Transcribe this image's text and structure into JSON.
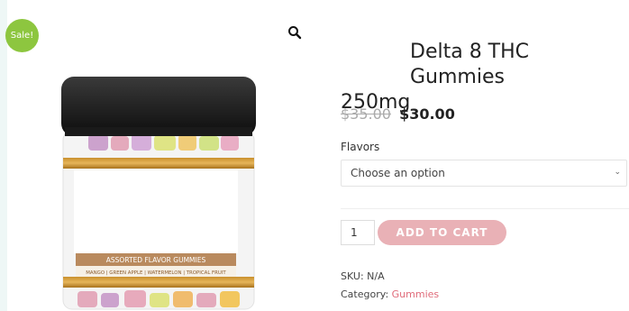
{
  "sale_badge": "Sale!",
  "product": {
    "title_line1": "Delta 8 THC Gummies",
    "title_line2": "250mg",
    "old_price": "$35.00",
    "new_price": "$30.00"
  },
  "jar_label": {
    "name": "ASSORTED FLAVOR GUMMIES",
    "flavors": "MANGO | GREEN APPLE | WATERMELON | TROPICAL FRUIT"
  },
  "variation": {
    "label": "Flavors",
    "placeholder": "Choose an option"
  },
  "cart": {
    "quantity": "1",
    "button_label": "ADD TO CART"
  },
  "meta": {
    "sku_label": "SKU:",
    "sku_value": "N/A",
    "category_label": "Category:",
    "category_value": "Gummies"
  },
  "colors": {
    "sale_badge": "#8dc63f",
    "add_to_cart": "#e9b1b6",
    "category_link": "#e06b7a"
  },
  "icons": [
    "zoom-icon",
    "chevron-down-icon"
  ]
}
